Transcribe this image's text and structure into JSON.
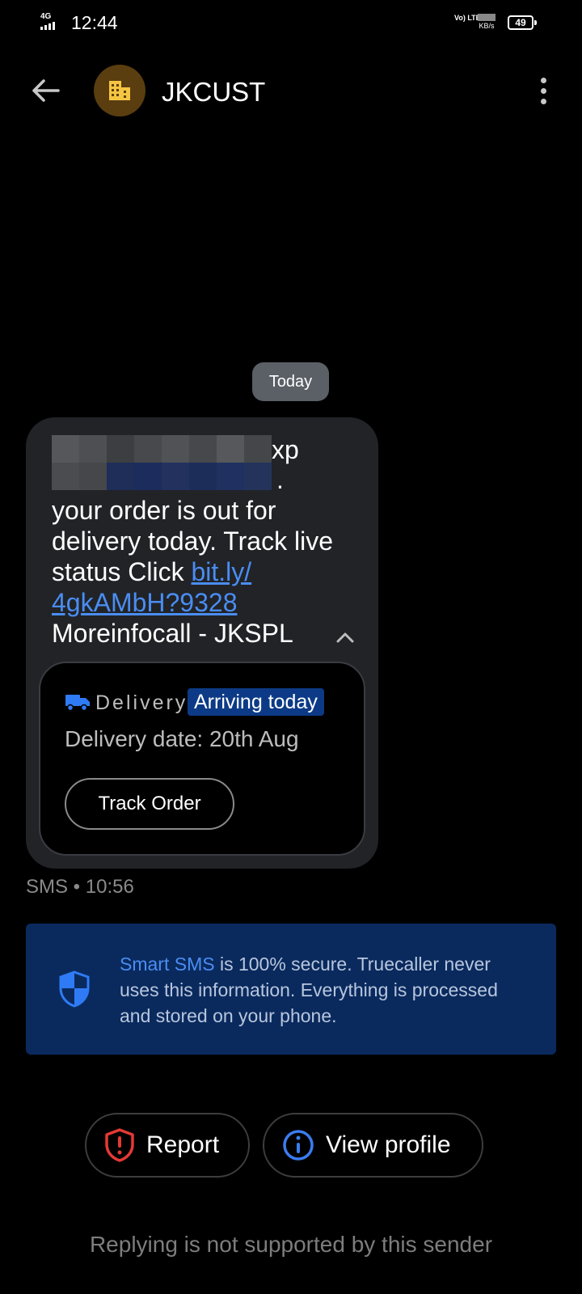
{
  "status_bar": {
    "network": "4G",
    "time": "12:44",
    "volte": "Vo) LTE",
    "speed_unit": "KB/s",
    "battery": "49"
  },
  "header": {
    "sender": "JKCUST"
  },
  "conversation": {
    "date_chip": "Today",
    "message": {
      "partial_top": "xp",
      "partial_dot": ".",
      "text_before_link": "your order is out for delivery today. Track live status Click ",
      "link": "bit.ly/ 4gkAMbH?9328",
      "text_after_link": "Moreinfocall - JKSPL"
    },
    "card": {
      "label": "Delivery",
      "status": "Arriving today",
      "date": "Delivery date: 20th Aug",
      "button": "Track Order"
    },
    "meta": "SMS • 10:56"
  },
  "banner": {
    "highlight": "Smart SMS",
    "text": " is 100% secure. Truecaller never uses this information. Everything is processed and stored on your phone."
  },
  "actions": {
    "report": "Report",
    "view_profile": "View profile"
  },
  "footer": "Replying is not supported by this sender",
  "colors": {
    "accent": "#4a8df2",
    "banner_bg": "#0a2a5e",
    "report_red": "#e53935"
  }
}
